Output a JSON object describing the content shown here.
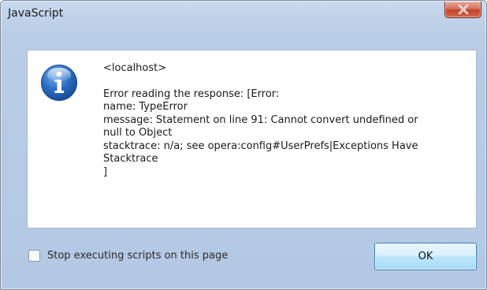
{
  "window": {
    "title": "JavaScript",
    "close_icon": "close-icon"
  },
  "message": {
    "icon": "info-icon",
    "origin": "<localhost>",
    "lines": [
      "Error reading the response: [Error:",
      "name: TypeError",
      "message: Statement on line 91: Cannot convert undefined or",
      "null to Object",
      "stacktrace: n/a; see  opera:config#UserPrefs|Exceptions Have",
      "Stacktrace",
      "]"
    ]
  },
  "footer": {
    "checkbox_label": "Stop executing scripts on this page",
    "checkbox_checked": false,
    "ok_label": "OK"
  },
  "colors": {
    "frame": "#b9cde6",
    "close_button": "#c2412b",
    "info_icon": "#2c6fc4",
    "ok_border": "#3c7fb1"
  }
}
